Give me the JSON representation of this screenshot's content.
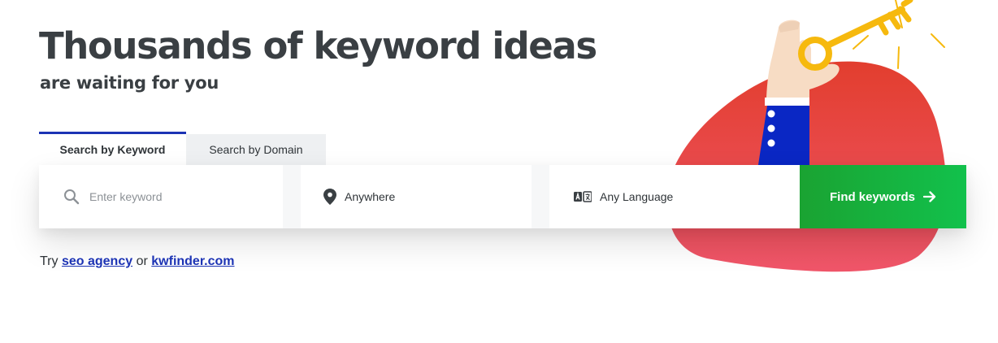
{
  "hero": {
    "title": "Thousands of keyword ideas",
    "subtitle": "are waiting for you"
  },
  "tabs": [
    {
      "label": "Search by Keyword",
      "active": true
    },
    {
      "label": "Search by Domain",
      "active": false
    }
  ],
  "search": {
    "keyword_placeholder": "Enter keyword",
    "keyword_value": "",
    "location_value": "Anywhere",
    "language_value": "Any Language",
    "submit_label": "Find keywords",
    "icons": {
      "keyword": "search-icon",
      "location": "map-pin-icon",
      "language": "translate-icon",
      "submit": "arrow-right-icon"
    }
  },
  "try_line": {
    "prefix": "Try",
    "link1": "seo agency",
    "middle": "or",
    "link2": "kwfinder.com"
  },
  "colors": {
    "accent_blue": "#1c33b4",
    "button_green": "#14b842",
    "blob_red": "#e8463f",
    "key_yellow": "#f6b90e",
    "sleeve_blue": "#0a27c4"
  }
}
